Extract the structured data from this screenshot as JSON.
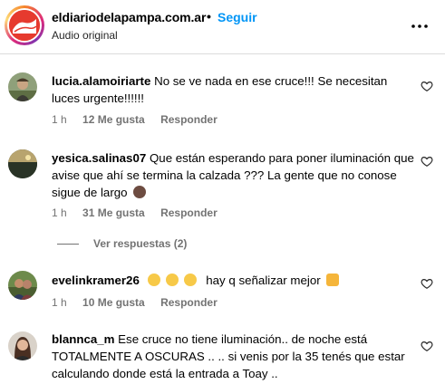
{
  "header": {
    "account": "eldiariodelapampa.com.ar",
    "separator": "•",
    "follow_label": "Seguir",
    "subtitle": "Audio original",
    "more_icon": "more-horizontal-icon"
  },
  "comments": [
    {
      "user": "lucia.alamoiriarte",
      "text": "No se ve nada en ese cruce!!! Se necesitan luces urgente!!!!!!",
      "time": "1 h",
      "likes": "12 Me gusta",
      "reply_label": "Responder"
    },
    {
      "user": "yesica.salinas07",
      "text": "Que están esperando para poner iluminación que avise que ahí se termina la calzada ??? La gente que no conose sigue de largo",
      "time": "1 h",
      "likes": "31 Me gusta",
      "reply_label": "Responder",
      "view_replies": "Ver respuestas (2)"
    },
    {
      "user": "evelinkramer26",
      "text": "hay q señalizar mejor",
      "time": "1 h",
      "likes": "10 Me gusta",
      "reply_label": "Responder"
    },
    {
      "user": "blannca_m",
      "text": "Ese cruce no tiene iluminación.. de noche está TOTALMENTE A OSCURAS .. .. si venis por la 35 tenés que estar calculando donde está la entrada a Toay .."
    }
  ],
  "colors": {
    "follow": "#0095f6",
    "meta": "#737373",
    "logo_red": "#e63a2e"
  }
}
